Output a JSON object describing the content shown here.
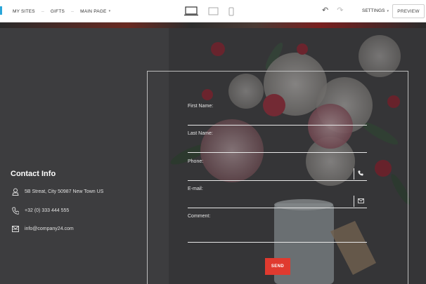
{
  "toolbar": {
    "nav": {
      "my_sites": "MY SITES",
      "gifts": "GIFTS",
      "main_page": "MAIN PAGE"
    },
    "settings": "SETTINGS",
    "preview": "PREVIEW"
  },
  "contact": {
    "title": "Contact Info",
    "address": "5B Streat, City 50987 New Town US",
    "phone": "+32 (0) 333 444 555",
    "email": "info@company24.com"
  },
  "form": {
    "first_name": "First Name:",
    "last_name": "Last Name:",
    "phone": "Phone:",
    "email": "E-mail:",
    "comment": "Comment:",
    "send": "SEND"
  },
  "colors": {
    "accent": "#e03a2f",
    "background": "#3d3d3f"
  }
}
